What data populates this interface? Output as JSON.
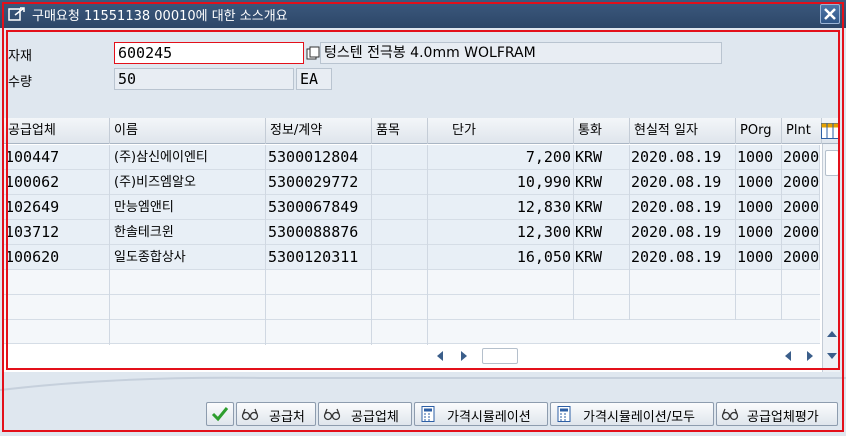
{
  "window": {
    "title": "구매요청 11551138 00010에 대한 소스개요"
  },
  "form": {
    "material_label": "자재",
    "material_value": "600245",
    "material_desc": "텅스텐 전극봉 4.0mm WOLFRAM",
    "quantity_label": "수량",
    "quantity_value": "50",
    "unit_value": "EA"
  },
  "table": {
    "columns": [
      "공급업체",
      "이름",
      "정보/계약",
      "품목",
      "단가",
      "통화",
      "현실적 일자",
      "POrg",
      "Plnt"
    ],
    "rows": [
      [
        "100447",
        "(주)삼신에이엔티",
        "5300012804",
        "",
        "7,200",
        "KRW",
        "2020.08.19",
        "1000",
        "2000"
      ],
      [
        "100062",
        "(주)비즈엠알오",
        "5300029772",
        "",
        "10,990",
        "KRW",
        "2020.08.19",
        "1000",
        "2000"
      ],
      [
        "102649",
        "만능엠앤티",
        "5300067849",
        "",
        "12,830",
        "KRW",
        "2020.08.19",
        "1000",
        "2000"
      ],
      [
        "103712",
        "한솔테크윈",
        "5300088876",
        "",
        "12,300",
        "KRW",
        "2020.08.19",
        "1000",
        "2000"
      ],
      [
        "100620",
        "일도종합상사",
        "5300120311",
        "",
        "16,050",
        "KRW",
        "2020.08.19",
        "1000",
        "2000"
      ]
    ]
  },
  "buttons": {
    "supplier_label": "공급처",
    "vendor_label": "공급업체",
    "price_sim_label": "가격시뮬레이션",
    "price_sim_all_label": "가격시뮬레이션/모두",
    "vendor_eval_label": "공급업체평가"
  },
  "colors": {
    "title_bar": "#2c4668",
    "highlight": "#e3101a",
    "row_bg": "#e8eff6"
  }
}
